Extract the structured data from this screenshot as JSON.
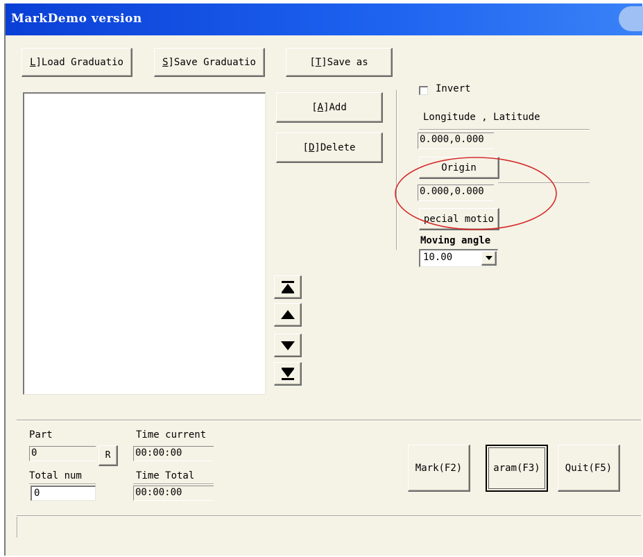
{
  "window": {
    "title": "MarkDemo version"
  },
  "toolbar": {
    "load_prefix": "L",
    "load_rest": "]Load Graduatio",
    "save_prefix": "S",
    "save_rest": "]Save Graduatio",
    "saveas_open": "[",
    "saveas_key": "T",
    "saveas_rest": "]Save as"
  },
  "edit": {
    "add_open": "[",
    "add_key": "A",
    "add_rest": "]Add",
    "delete_open": "[",
    "delete_key": "D",
    "delete_rest": "]Delete"
  },
  "right_panel": {
    "invert_label": "Invert",
    "invert_checked": false,
    "coord_header": "Longitude , Latitude",
    "coord_value": "0.000,0.000",
    "origin_button": "Origin",
    "origin_value": "0.000,0.000",
    "special_motion_button": "pecial motio",
    "moving_angle_label": "Moving angle",
    "moving_angle_value": "10.00"
  },
  "list_nav": {
    "top_icon": "move-to-top-icon",
    "up_icon": "move-up-icon",
    "down_icon": "move-down-icon",
    "bottom_icon": "move-to-bottom-icon"
  },
  "status": {
    "part_label": "Part",
    "part_value": "0",
    "reset_button": "R",
    "time_current_label": "Time current",
    "time_current_value": "00:00:00",
    "total_num_label": "Total num",
    "total_num_value": "0",
    "time_total_label": "Time Total",
    "time_total_value": "00:00:00"
  },
  "actions": {
    "mark": "Mark(F2)",
    "param": "aram(F3)",
    "quit": "Quit(F5)"
  },
  "annotation": {
    "color": "#d42a2a"
  }
}
